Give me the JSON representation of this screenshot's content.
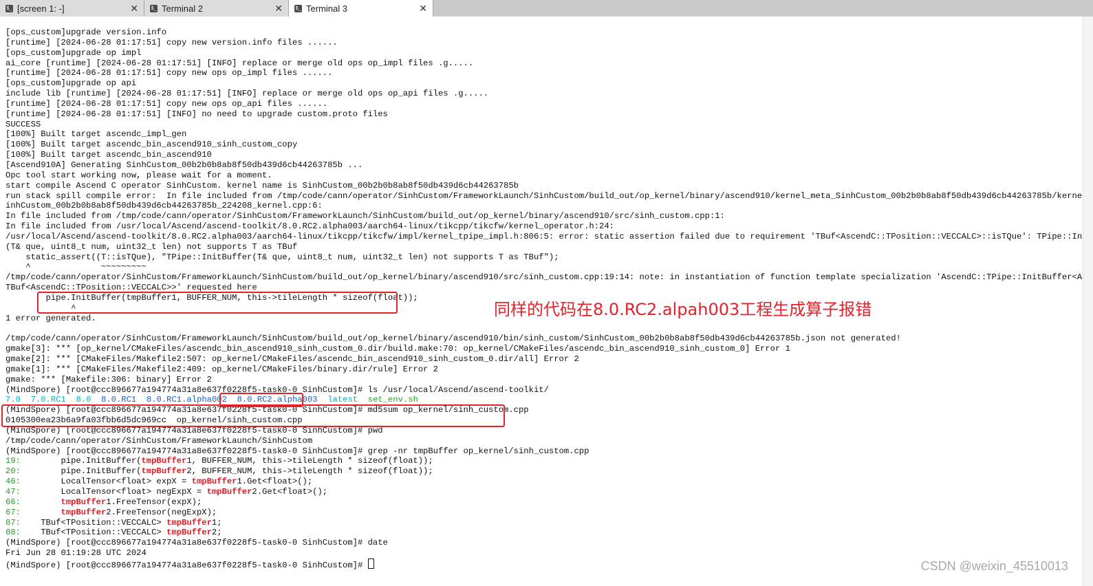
{
  "tabs": [
    {
      "label": "[screen 1: -]",
      "close": "✕",
      "active": false
    },
    {
      "label": "Terminal 2",
      "close": "✕",
      "active": false
    },
    {
      "label": "Terminal 3",
      "close": "✕",
      "active": true
    }
  ],
  "terminal": {
    "lines": [
      "[ops_custom]upgrade version.info",
      "[runtime] [2024-06-28 01:17:51] copy new version.info files ......",
      "[ops_custom]upgrade op impl",
      "ai_core [runtime] [2024-06-28 01:17:51] [INFO] replace or merge old ops op_impl files .g.....",
      "[runtime] [2024-06-28 01:17:51] copy new ops op_impl files ......",
      "[ops_custom]upgrade op api",
      "include lib [runtime] [2024-06-28 01:17:51] [INFO] replace or merge old ops op_api files .g.....",
      "[runtime] [2024-06-28 01:17:51] copy new ops op_api files ......",
      "[runtime] [2024-06-28 01:17:51] [INFO] no need to upgrade custom.proto files",
      "SUCCESS",
      "[100%] Built target ascendc_impl_gen",
      "[100%] Built target ascendc_bin_ascend910_sinh_custom_copy",
      "[100%] Built target ascendc_bin_ascend910",
      "[Ascend910A] Generating SinhCustom_00b2b0b8ab8f50db439d6cb44263785b ...",
      "Opc tool start working now, please wait for a moment.",
      "start compile Ascend C operator SinhCustom. kernel name is SinhCustom_00b2b0b8ab8f50db439d6cb44263785b",
      "run stack spill compile error:  In file included from /tmp/code/cann/operator/SinhCustom/FrameworkLaunch/SinhCustom/build_out/op_kernel/binary/ascend910/kernel_meta_SinhCustom_00b2b0b8ab8f50db439d6cb44263785b/kernel_meta/S",
      "inhCustom_00b2b0b8ab8f50db439d6cb44263785b_224208_kernel.cpp:6:",
      "In file included from /tmp/code/cann/operator/SinhCustom/FrameworkLaunch/SinhCustom/build_out/op_kernel/binary/ascend910/src/sinh_custom.cpp:1:",
      "In file included from /usr/local/Ascend/ascend-toolkit/8.0.RC2.alpha003/aarch64-linux/tikcpp/tikcfw/kernel_operator.h:24:",
      "/usr/local/Ascend/ascend-toolkit/8.0.RC2.alpha003/aarch64-linux/tikcpp/tikcfw/impl/kernel_tpipe_impl.h:806:5: error: static assertion failed due to requirement 'TBuf<AscendC::TPosition::VECCALC>::isTQue': TPipe::InitBuffer",
      "(T& que, uint8_t num, uint32_t len) not supports T as TBuf",
      "    static_assert((T::isTQue), \"TPipe::InitBuffer(T& que, uint8_t num, uint32_t len) not supports T as TBuf\");",
      "    ^              ~~~~~~~~~",
      "/tmp/code/cann/operator/SinhCustom/FrameworkLaunch/SinhCustom/build_out/op_kernel/binary/ascend910/src/sinh_custom.cpp:19:14: note: in instantiation of function template specialization 'AscendC::TPipe::InitBuffer<AscendC::",
      "TBuf<AscendC::TPosition::VECCALC>>' requested here",
      "        pipe.InitBuffer(tmpBuffer1, BUFFER_NUM, this->tileLength * sizeof(float));",
      "             ^",
      "1 error generated.",
      "",
      "/tmp/code/cann/operator/SinhCustom/FrameworkLaunch/SinhCustom/build_out/op_kernel/binary/ascend910/bin/sinh_custom/SinhCustom_00b2b0b8ab8f50db439d6cb44263785b.json not generated!",
      "gmake[3]: *** [op_kernel/CMakeFiles/ascendc_bin_ascend910_sinh_custom_0.dir/build.make:70: op_kernel/CMakeFiles/ascendc_bin_ascend910_sinh_custom_0] Error 1",
      "gmake[2]: *** [CMakeFiles/Makefile2:507: op_kernel/CMakeFiles/ascendc_bin_ascend910_sinh_custom_0.dir/all] Error 2",
      "gmake[1]: *** [CMakeFiles/Makefile2:409: op_kernel/CMakeFiles/binary.dir/rule] Error 2",
      "gmake: *** [Makefile:306: binary] Error 2",
      "(MindSpore) [root@ccc896677a194774a31a8e637f0228f5-task0-0 SinhCustom]# ls /usr/local/Ascend/ascend-toolkit/"
    ],
    "ls_output": [
      {
        "text": "7.0",
        "color": "cyan"
      },
      {
        "text": "  ",
        "color": ""
      },
      {
        "text": "7.0.RC1",
        "color": "cyan"
      },
      {
        "text": "  ",
        "color": ""
      },
      {
        "text": "8.0",
        "color": "cyan"
      },
      {
        "text": "  ",
        "color": ""
      },
      {
        "text": "8.0.RC1",
        "color": "blue"
      },
      {
        "text": "  ",
        "color": ""
      },
      {
        "text": "8.0.RC1.alpha002",
        "color": "blue"
      },
      {
        "text": "  ",
        "color": ""
      },
      {
        "text": "8.0.RC2.alpha003",
        "color": "blue"
      },
      {
        "text": "  ",
        "color": ""
      },
      {
        "text": "latest",
        "color": "cyan"
      },
      {
        "text": "  ",
        "color": ""
      },
      {
        "text": "set_env.sh",
        "color": "green"
      }
    ],
    "lines2": [
      "(MindSpore) [root@ccc896677a194774a31a8e637f0228f5-task0-0 SinhCustom]# md5sum op_kernel/sinh_custom.cpp",
      "0105300ea23b6a9fa03fbb6d5dc969cc  op_kernel/sinh_custom.cpp",
      "(MindSpore) [root@ccc896677a194774a31a8e637f0228f5-task0-0 SinhCustom]# pwd",
      "/tmp/code/cann/operator/SinhCustom/FrameworkLaunch/SinhCustom",
      "(MindSpore) [root@ccc896677a194774a31a8e637f0228f5-task0-0 SinhCustom]# grep -nr tmpBuffer op_kernel/sinh_custom.cpp"
    ],
    "grep": [
      {
        "num": "19:",
        "pre": "        pipe.InitBuffer(",
        "hit": "tmpBuffer",
        "post": "1, BUFFER_NUM, this->tileLength * sizeof(float));"
      },
      {
        "num": "20:",
        "pre": "        pipe.InitBuffer(",
        "hit": "tmpBuffer",
        "post": "2, BUFFER_NUM, this->tileLength * sizeof(float));"
      },
      {
        "num": "46:",
        "pre": "        LocalTensor<float> expX = ",
        "hit": "tmpBuffer",
        "post": "1.Get<float>();"
      },
      {
        "num": "47:",
        "pre": "        LocalTensor<float> negExpX = ",
        "hit": "tmpBuffer",
        "post": "2.Get<float>();"
      },
      {
        "num": "66:",
        "pre": "        ",
        "hit": "tmpBuffer",
        "post": "1.FreeTensor(expX);"
      },
      {
        "num": "67:",
        "pre": "        ",
        "hit": "tmpBuffer",
        "post": "2.FreeTensor(negExpX);"
      },
      {
        "num": "87:",
        "pre": "    TBuf<TPosition::VECCALC> ",
        "hit": "tmpBuffer",
        "post": "1;"
      },
      {
        "num": "88:",
        "pre": "    TBuf<TPosition::VECCALC> ",
        "hit": "tmpBuffer",
        "post": "2;"
      }
    ],
    "lines3": [
      "(MindSpore) [root@ccc896677a194774a31a8e637f0228f5-task0-0 SinhCustom]# date",
      "Fri Jun 28 01:19:28 UTC 2024"
    ],
    "prompt": "(MindSpore) [root@ccc896677a194774a31a8e637f0228f5-task0-0 SinhCustom]# "
  },
  "annotation": "同样的代码在8.0.RC2.alpah003工程生成算子报错",
  "watermark": "CSDN @weixin_45510013",
  "colors": {
    "cyan": "#00b5c8",
    "blue": "#1b5ec7",
    "green": "#2aa32a",
    "highlight_red": "#e3222a"
  }
}
